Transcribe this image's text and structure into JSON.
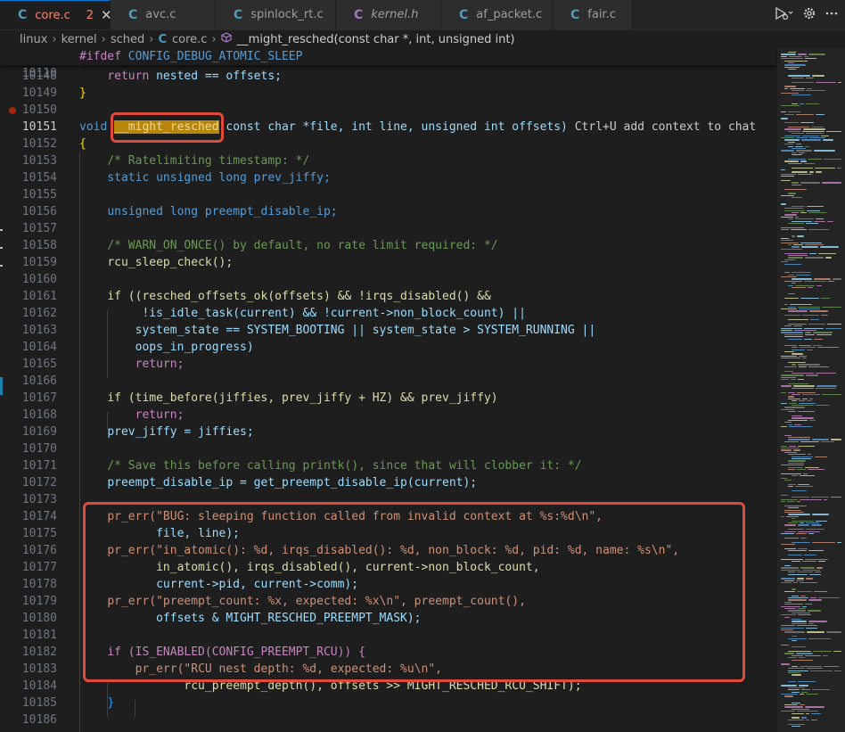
{
  "tabs": [
    {
      "label": "core.c",
      "problems": "2",
      "close": "✕",
      "icon": "C",
      "active": true
    },
    {
      "label": "avc.c",
      "icon": "C"
    },
    {
      "label": "spinlock_rt.c",
      "icon": "C"
    },
    {
      "label": "kernel.h",
      "icon": "C"
    },
    {
      "label": "af_packet.c",
      "icon": "C"
    },
    {
      "label": "fair.c",
      "icon": "C"
    }
  ],
  "breadcrumb": {
    "segments": [
      "linux",
      "kernel",
      "sched"
    ],
    "file": "core.c",
    "symbol": "__might_resched(const char *, int, unsigned int)"
  },
  "sticky": {
    "number": "10110",
    "directive": "#ifdef",
    "macro": "CONFIG_DEBUG_ATOMIC_SLEEP"
  },
  "line_numbers": [
    "10148",
    "10149",
    "10150",
    "10151",
    "10152",
    "10153",
    "10154",
    "10155",
    "10156",
    "10157",
    "10158",
    "10159",
    "10160",
    "10161",
    "10162",
    "10163",
    "10164",
    "10165",
    "10166",
    "10167",
    "10168",
    "10169",
    "10170",
    "10171",
    "10172",
    "10173",
    "10174",
    "10175",
    "10176",
    "10177",
    "10178",
    "10179",
    "10180",
    "10181",
    "10182",
    "10183",
    "10184",
    "10185",
    "10186"
  ],
  "code": {
    "l10148": {
      "kw": "return",
      "expr": "nested == offsets;"
    },
    "l10149": "}",
    "l10151": {
      "void": "void",
      "name": "__might_resched",
      "params": "(const char *file, int line, unsigned int offsets)",
      "hint": "Ctrl+U add context to chat"
    },
    "l10152": "{",
    "l10153": "/* Ratelimiting timestamp: */",
    "l10154": "static unsigned long prev_jiffy;",
    "l10156": "unsigned long preempt_disable_ip;",
    "l10158": "/* WARN_ON_ONCE() by default, no rate limit required: */",
    "l10159": "rcu_sleep_check();",
    "l10161": "if ((resched_offsets_ok(offsets) && !irqs_disabled() &&",
    "l10162": "!is_idle_task(current) && !current->non_block_count) ||",
    "l10163": "system_state == SYSTEM_BOOTING || system_state > SYSTEM_RUNNING ||",
    "l10164": "oops_in_progress)",
    "l10165": "return;",
    "l10167": "if (time_before(jiffies, prev_jiffy + HZ) && prev_jiffy)",
    "l10168": "return;",
    "l10169": "prev_jiffy = jiffies;",
    "l10171": "/* Save this before calling printk(), since that will clobber it: */",
    "l10172": "preempt_disable_ip = get_preempt_disable_ip(current);",
    "l10174": "pr_err(\"BUG: sleeping function called from invalid context at %s:%d\\n\",",
    "l10175": "file, line);",
    "l10176": "pr_err(\"in_atomic(): %d, irqs_disabled(): %d, non_block: %d, pid: %d, name: %s\\n\",",
    "l10177": "in_atomic(), irqs_disabled(), current->non_block_count,",
    "l10178": "current->pid, current->comm);",
    "l10179": "pr_err(\"preempt_count: %x, expected: %x\\n\", preempt_count(),",
    "l10180": "offsets & MIGHT_RESCHED_PREEMPT_MASK);",
    "l10182": "if (IS_ENABLED(CONFIG_PREEMPT_RCU)) {",
    "l10183": "pr_err(\"RCU nest depth: %d, expected: %u\\n\",",
    "l10184": "rcu_preempt_depth(), offsets >> MIGHT_RESCHED_RCU_SHIFT);",
    "l10185": "}"
  },
  "colors": {
    "active_tab_text": "#f48771",
    "annotation_box": "#e04a3a",
    "highlight": "#b8860b",
    "breakpoint": "#a1260d"
  }
}
